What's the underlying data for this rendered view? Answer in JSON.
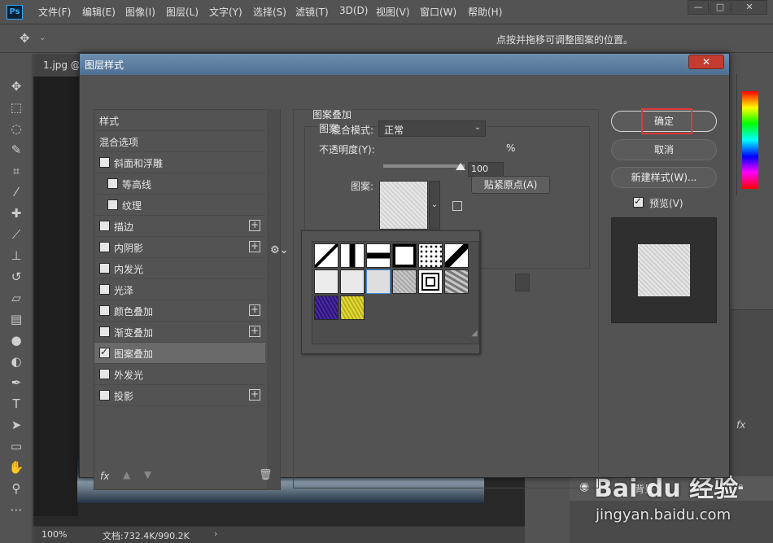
{
  "app": {
    "logo": "Ps"
  },
  "menu": [
    "文件(F)",
    "编辑(E)",
    "图像(I)",
    "图层(L)",
    "文字(Y)",
    "选择(S)",
    "滤镜(T)",
    "3D(D)",
    "视图(V)",
    "窗口(W)",
    "帮助(H)"
  ],
  "window_buttons": [
    "—",
    "□",
    "✕"
  ],
  "options": {
    "hint": "点按并拖移可调整图案的位置。"
  },
  "document": {
    "tab_label": "1.jpg @",
    "zoom": "100%",
    "doc_info": "文档:732.4K/990.2K"
  },
  "dialog": {
    "title": "图层样式",
    "close_label": "✕",
    "style_list": [
      {
        "label": "样式",
        "checkbox": false,
        "plus": false,
        "indent": 0
      },
      {
        "label": "混合选项",
        "checkbox": false,
        "plus": false,
        "indent": 0
      },
      {
        "label": "斜面和浮雕",
        "checkbox": true,
        "checked": false,
        "plus": false,
        "indent": 0
      },
      {
        "label": "等高线",
        "checkbox": true,
        "checked": false,
        "plus": false,
        "indent": 1
      },
      {
        "label": "纹理",
        "checkbox": true,
        "checked": false,
        "plus": false,
        "indent": 1
      },
      {
        "label": "描边",
        "checkbox": true,
        "checked": false,
        "plus": true,
        "indent": 0
      },
      {
        "label": "内阴影",
        "checkbox": true,
        "checked": false,
        "plus": true,
        "indent": 0
      },
      {
        "label": "内发光",
        "checkbox": true,
        "checked": false,
        "plus": false,
        "indent": 0
      },
      {
        "label": "光泽",
        "checkbox": true,
        "checked": false,
        "plus": false,
        "indent": 0
      },
      {
        "label": "颜色叠加",
        "checkbox": true,
        "checked": false,
        "plus": true,
        "indent": 0
      },
      {
        "label": "渐变叠加",
        "checkbox": true,
        "checked": false,
        "plus": true,
        "indent": 0
      },
      {
        "label": "图案叠加",
        "checkbox": true,
        "checked": true,
        "plus": false,
        "indent": 0,
        "selected": true
      },
      {
        "label": "外发光",
        "checkbox": true,
        "checked": false,
        "plus": false,
        "indent": 0
      },
      {
        "label": "投影",
        "checkbox": true,
        "checked": false,
        "plus": true,
        "indent": 0
      }
    ],
    "footer_icons": [
      "fx-icon",
      "move-up-icon",
      "move-down-icon",
      "trash-icon"
    ],
    "footer_fx": "fx",
    "section_title": "图案叠加",
    "group_title": "图案",
    "blend_mode_label": "混合模式:",
    "blend_mode_value": "正常",
    "opacity_label": "不透明度(Y):",
    "opacity_value": "100",
    "opacity_unit": "%",
    "pattern_label": "图案:",
    "snap_button": "贴紧原点(A)",
    "ok_button": "确定",
    "cancel_button": "取消",
    "new_style_button": "新建样式(W)...",
    "preview_label": "预览(V)",
    "preview_checked": true
  },
  "pattern_swatches": [
    {
      "name": "diagonal-line-pattern",
      "color": "#ffffff"
    },
    {
      "name": "vertical-bar-pattern",
      "color": "#ffffff"
    },
    {
      "name": "horizontal-bar-pattern",
      "color": "#ffffff"
    },
    {
      "name": "black-border-pattern",
      "color": "#ffffff"
    },
    {
      "name": "dot-pattern",
      "color": "#ffffff"
    },
    {
      "name": "stair-pattern",
      "color": "#ffffff"
    },
    {
      "name": "paper-pattern-1",
      "color": "#ececec"
    },
    {
      "name": "paper-pattern-2",
      "color": "#e9e9e9"
    },
    {
      "name": "paper-pattern-3-selected",
      "color": "#dedede"
    },
    {
      "name": "noise-pattern",
      "color": "#bdbdbd"
    },
    {
      "name": "concentric-square-pattern",
      "color": "#ffffff"
    },
    {
      "name": "camo-pattern",
      "color": "#9a9a9a"
    },
    {
      "name": "purple-pattern",
      "color": "#3a1d8c"
    },
    {
      "name": "yellow-pattern",
      "color": "#c9c31e"
    }
  ],
  "watermark": {
    "text": "Bai du 经验",
    "url": "jingyan.baidu.com"
  },
  "layers": {
    "name": "背景"
  }
}
